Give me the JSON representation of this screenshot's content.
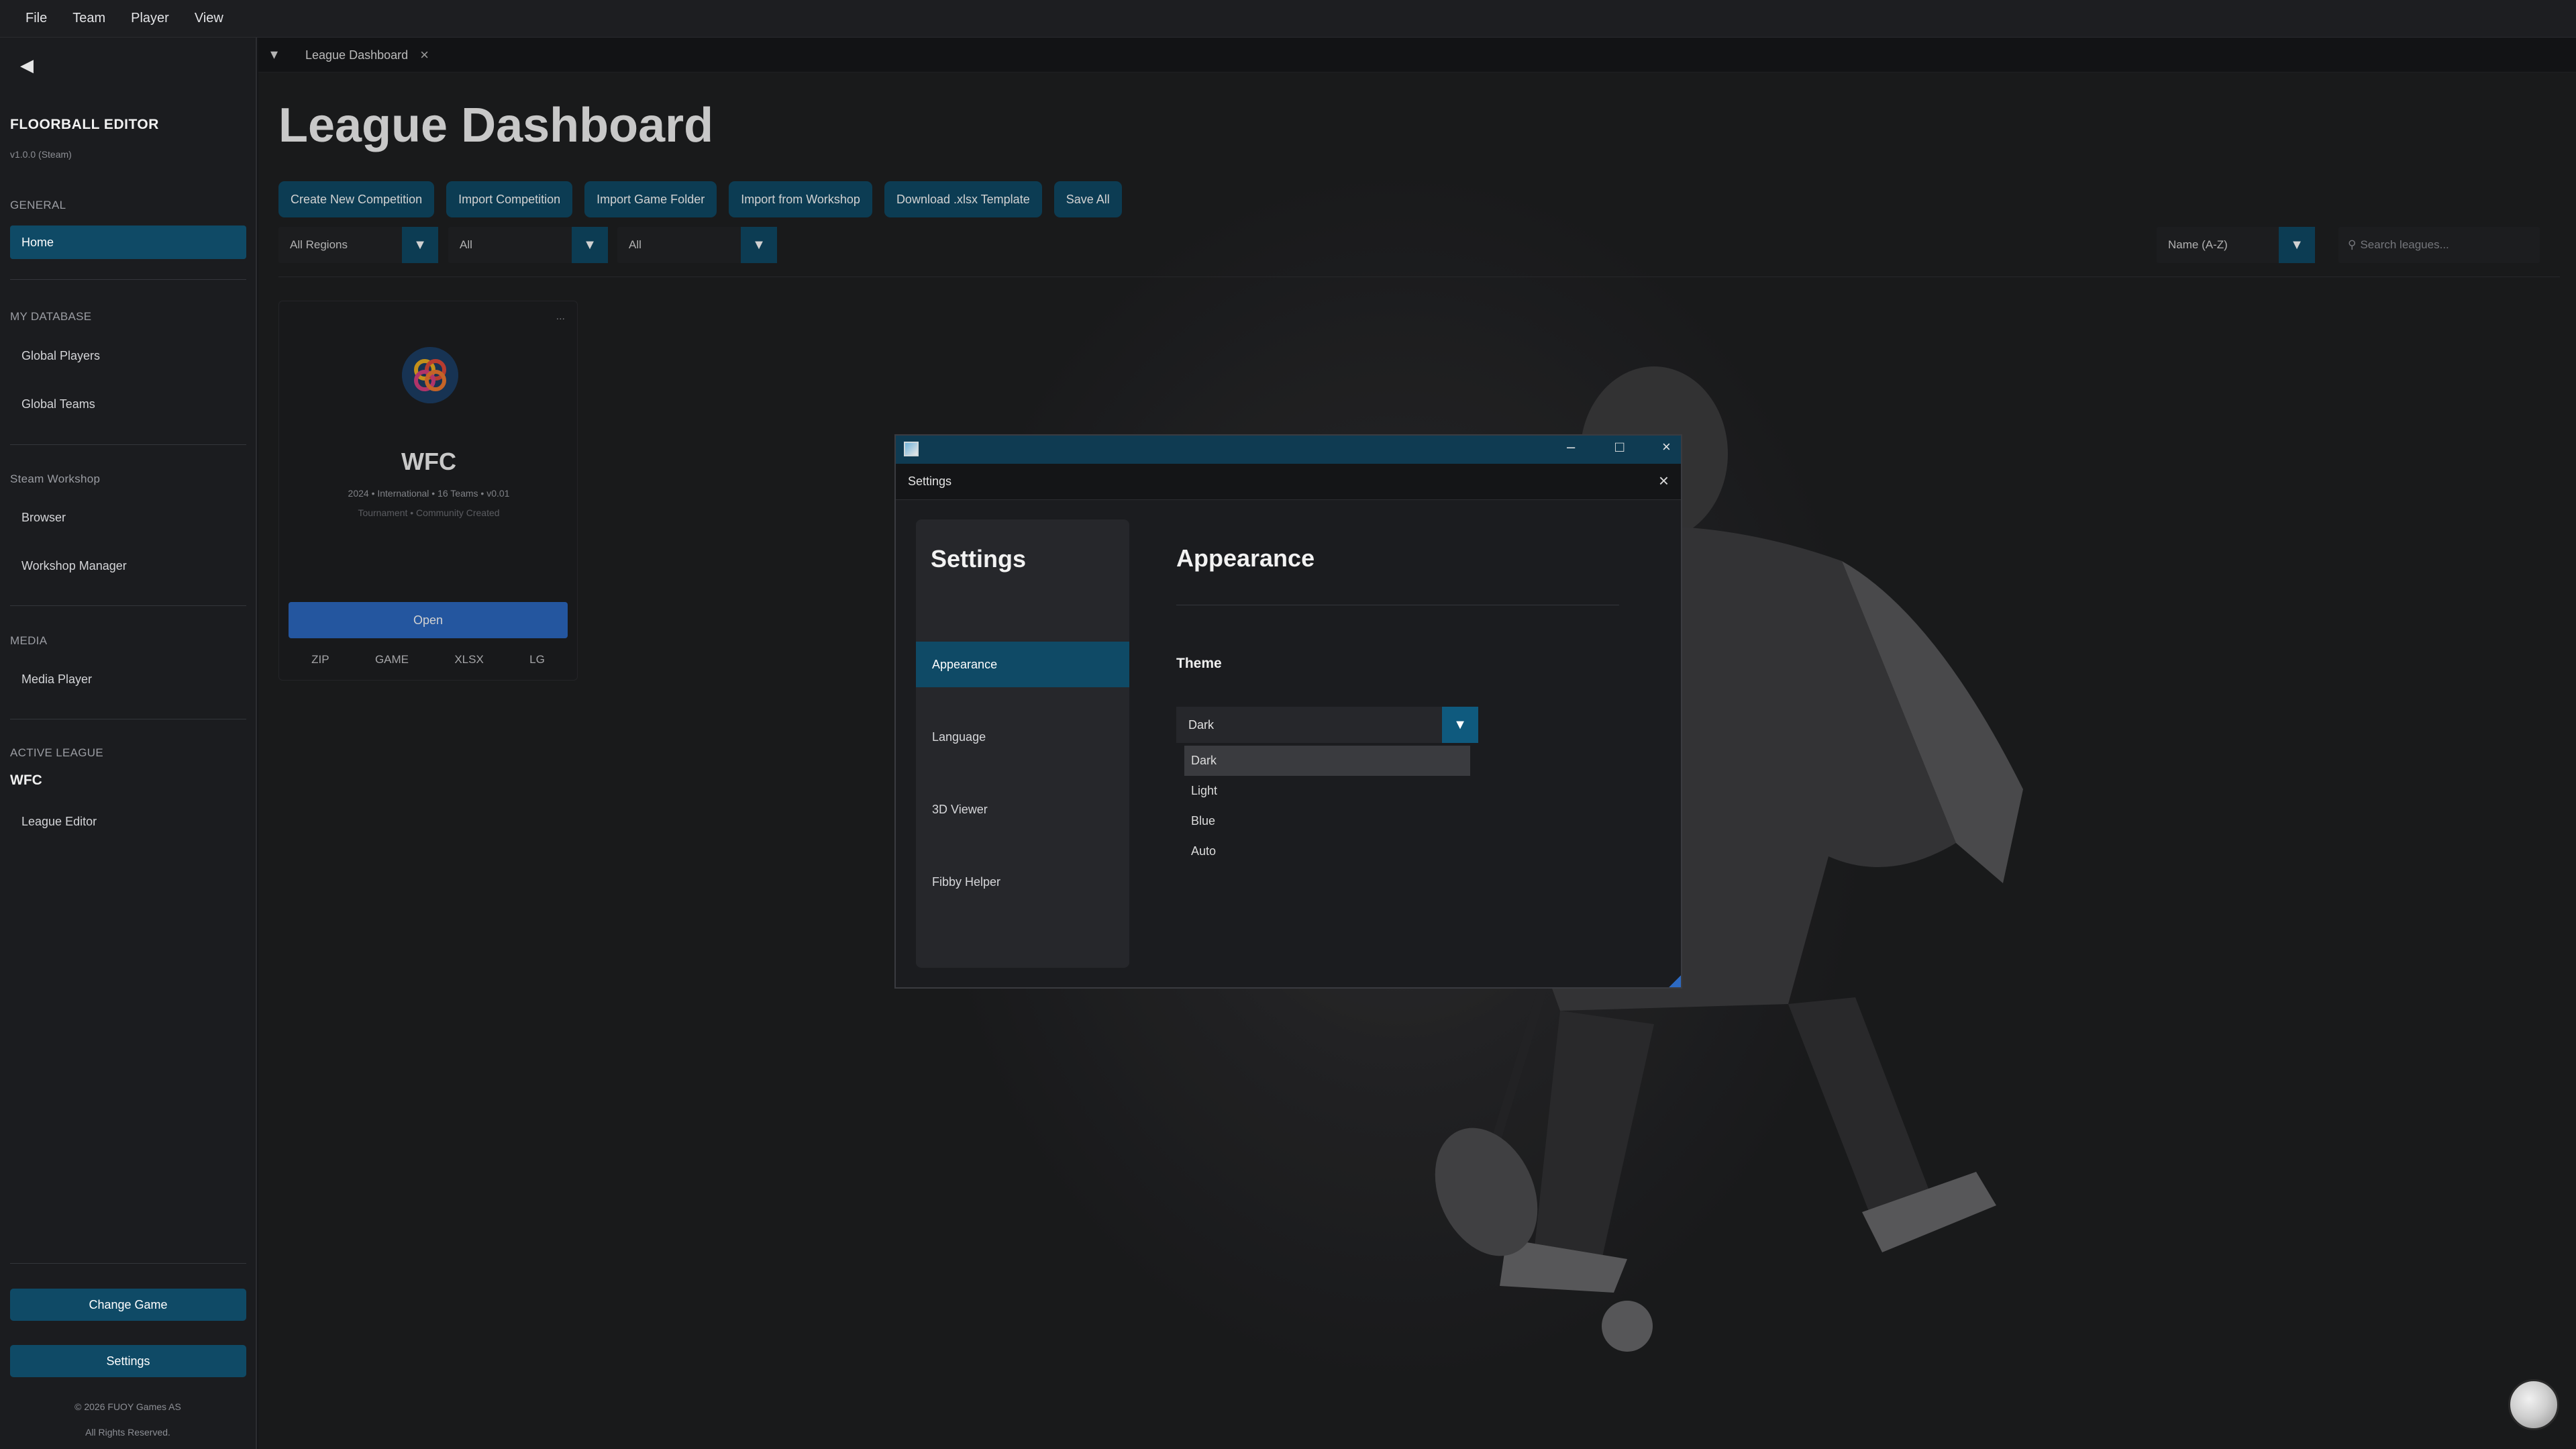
{
  "menubar": {
    "items": [
      "File",
      "Team",
      "Player",
      "View"
    ]
  },
  "sidebar": {
    "app_name": "FLOORBALL EDITOR",
    "version": "v1.0.0 (Steam)",
    "sections": {
      "general": "GENERAL",
      "my_database": "MY DATABASE",
      "steam_workshop": "Steam Workshop",
      "media": "MEDIA",
      "active_league": "ACTIVE LEAGUE"
    },
    "items": {
      "home": "Home",
      "global_players": "Global Players",
      "global_teams": "Global Teams",
      "browser": "Browser",
      "workshop_manager": "Workshop Manager",
      "media_player": "Media Player",
      "league_editor": "League Editor"
    },
    "active_league_name": "WFC",
    "change_game": "Change Game",
    "settings": "Settings",
    "copyright": "© 2026 FUOY Games AS",
    "rights": "All Rights Reserved."
  },
  "tab": {
    "label": "League Dashboard"
  },
  "dashboard": {
    "title": "League Dashboard",
    "toolbar": {
      "create": "Create New Competition",
      "import": "Import Competition",
      "import_folder": "Import Game Folder",
      "import_workshop": "Import from Workshop",
      "download_template": "Download .xlsx Template",
      "save_all": "Save All"
    },
    "filters": {
      "region": "All Regions",
      "filter2": "All",
      "filter3": "All",
      "sort": "Name (A-Z)",
      "search_placeholder": "Search leagues..."
    },
    "card": {
      "name": "WFC",
      "dots": "...",
      "meta": "2024 • International • 16 Teams • v0.01",
      "meta2": "Tournament • Community Created",
      "open": "Open",
      "formats": [
        "ZIP",
        "GAME",
        "XLSX",
        "LG"
      ]
    }
  },
  "settings_dialog": {
    "window_title": "Settings",
    "nav_title": "Settings",
    "nav_items": [
      "Appearance",
      "Language",
      "3D Viewer",
      "Fibby Helper"
    ],
    "active_nav": "Appearance",
    "section_title": "Appearance",
    "theme_label": "Theme",
    "theme_value": "Dark",
    "theme_options": [
      "Dark",
      "Light",
      "Blue",
      "Auto"
    ]
  },
  "colors": {
    "accent": "#0f4a66",
    "open_button": "#2d6ac3",
    "background": "#141518"
  }
}
